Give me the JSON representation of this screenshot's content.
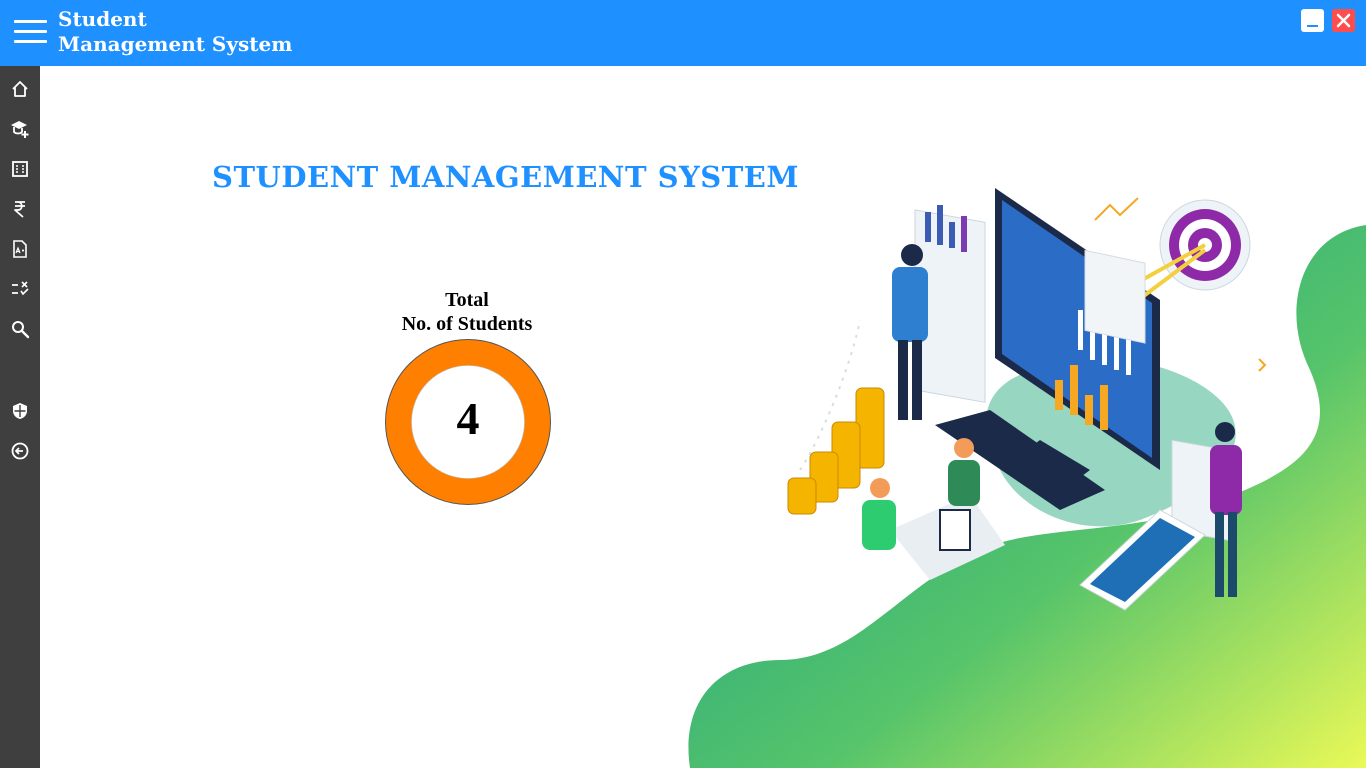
{
  "app": {
    "title_line1": "Student",
    "title_line2": "Management System"
  },
  "header": {
    "menu_icon": "hamburger-icon",
    "minimize_icon": "minimize-icon",
    "close_icon": "close-icon"
  },
  "sidebar": {
    "items": [
      {
        "icon": "home-icon"
      },
      {
        "icon": "add-student-icon"
      },
      {
        "icon": "building-icon"
      },
      {
        "icon": "rupee-icon"
      },
      {
        "icon": "report-card-icon"
      },
      {
        "icon": "attendance-icon"
      },
      {
        "icon": "search-icon"
      },
      {
        "icon": "shield-icon"
      },
      {
        "icon": "logout-icon"
      }
    ]
  },
  "main": {
    "heading": "STUDENT MANAGEMENT SYSTEM",
    "stat_label_line1": "Total",
    "stat_label_line2": "No. of Students",
    "stat_value": "4"
  },
  "colors": {
    "header": "#1e90ff",
    "sidebar": "#3f3f3f",
    "accent": "#1e90ff",
    "donut": "#ff8000",
    "close": "#ff4c4c"
  }
}
